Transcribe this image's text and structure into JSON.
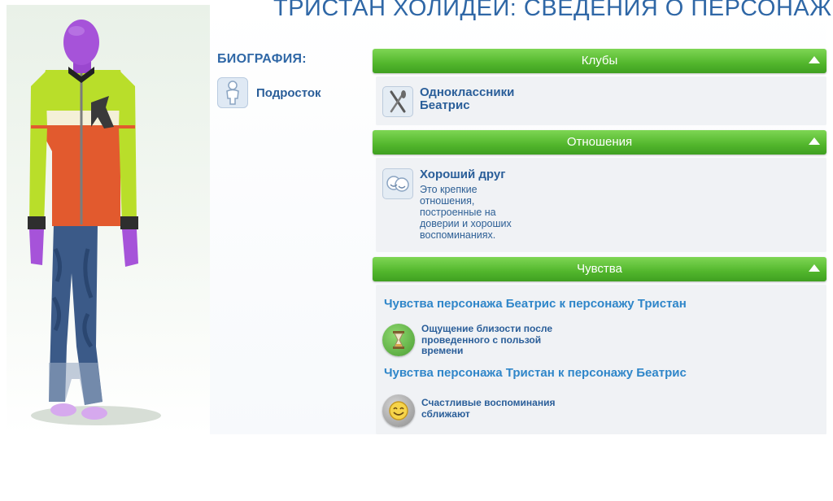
{
  "title": "ТРИСТАН ХОЛИДЕЙ: СВЕДЕНИЯ О ПЕРСОНАЖЕ",
  "biography": {
    "heading": "БИОГРАФИЯ:",
    "age_label": "Подросток",
    "age_icon": "teen-figure-icon"
  },
  "sections": {
    "clubs": {
      "header": "Клубы",
      "items": [
        {
          "title_line1": "Одноклассники",
          "title_line2": "Беатрис",
          "icon": "fork-knife-icon"
        }
      ]
    },
    "relationships": {
      "header": "Отношения",
      "items": [
        {
          "title": "Хороший друг",
          "desc_lines": [
            "Это крепкие",
            "отношения,",
            "построенные на",
            "доверии и хороших",
            "воспоминаниях."
          ],
          "icon": "friends-faces-icon"
        }
      ]
    },
    "feelings": {
      "header": "Чувства",
      "groups": [
        {
          "heading": "Чувства персонажа Беатрис к персонажу Тристан",
          "item_lines": [
            "Ощущение близости после",
            "проведенного с пользой",
            "времени"
          ],
          "icon": "hourglass-icon",
          "icon_color": "#5db043"
        },
        {
          "heading": "Чувства персонажа Тристан к персонажу Беатрис",
          "item_lines": [
            "Счастливые воспоминания",
            "сближают"
          ],
          "icon": "smiley-face-icon",
          "icon_color": "#9a9a9a"
        }
      ]
    }
  },
  "colors": {
    "accent_green": "#52b62c",
    "title_blue": "#2f67a6",
    "heading_blue": "#2f86c9"
  }
}
